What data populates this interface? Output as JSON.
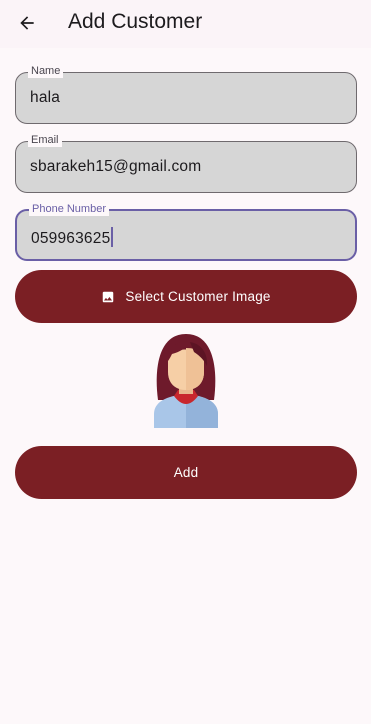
{
  "appbar": {
    "title": "Add Customer",
    "back_icon": "arrow-back-icon"
  },
  "form": {
    "name": {
      "label": "Name",
      "value": "hala"
    },
    "email": {
      "label": "Email",
      "value": "sbarakeh15@gmail.com"
    },
    "phone": {
      "label": "Phone Number",
      "value": "059963625"
    }
  },
  "buttons": {
    "select_image_label": "Select Customer Image",
    "select_image_icon": "image-icon",
    "add_label": "Add"
  },
  "avatar": {
    "icon": "woman-avatar-icon"
  },
  "colors": {
    "primary": "#7b1f24",
    "focus_outline": "#6a5fa6",
    "field_fill": "#d6d6d6",
    "background": "#fdf8fa"
  }
}
